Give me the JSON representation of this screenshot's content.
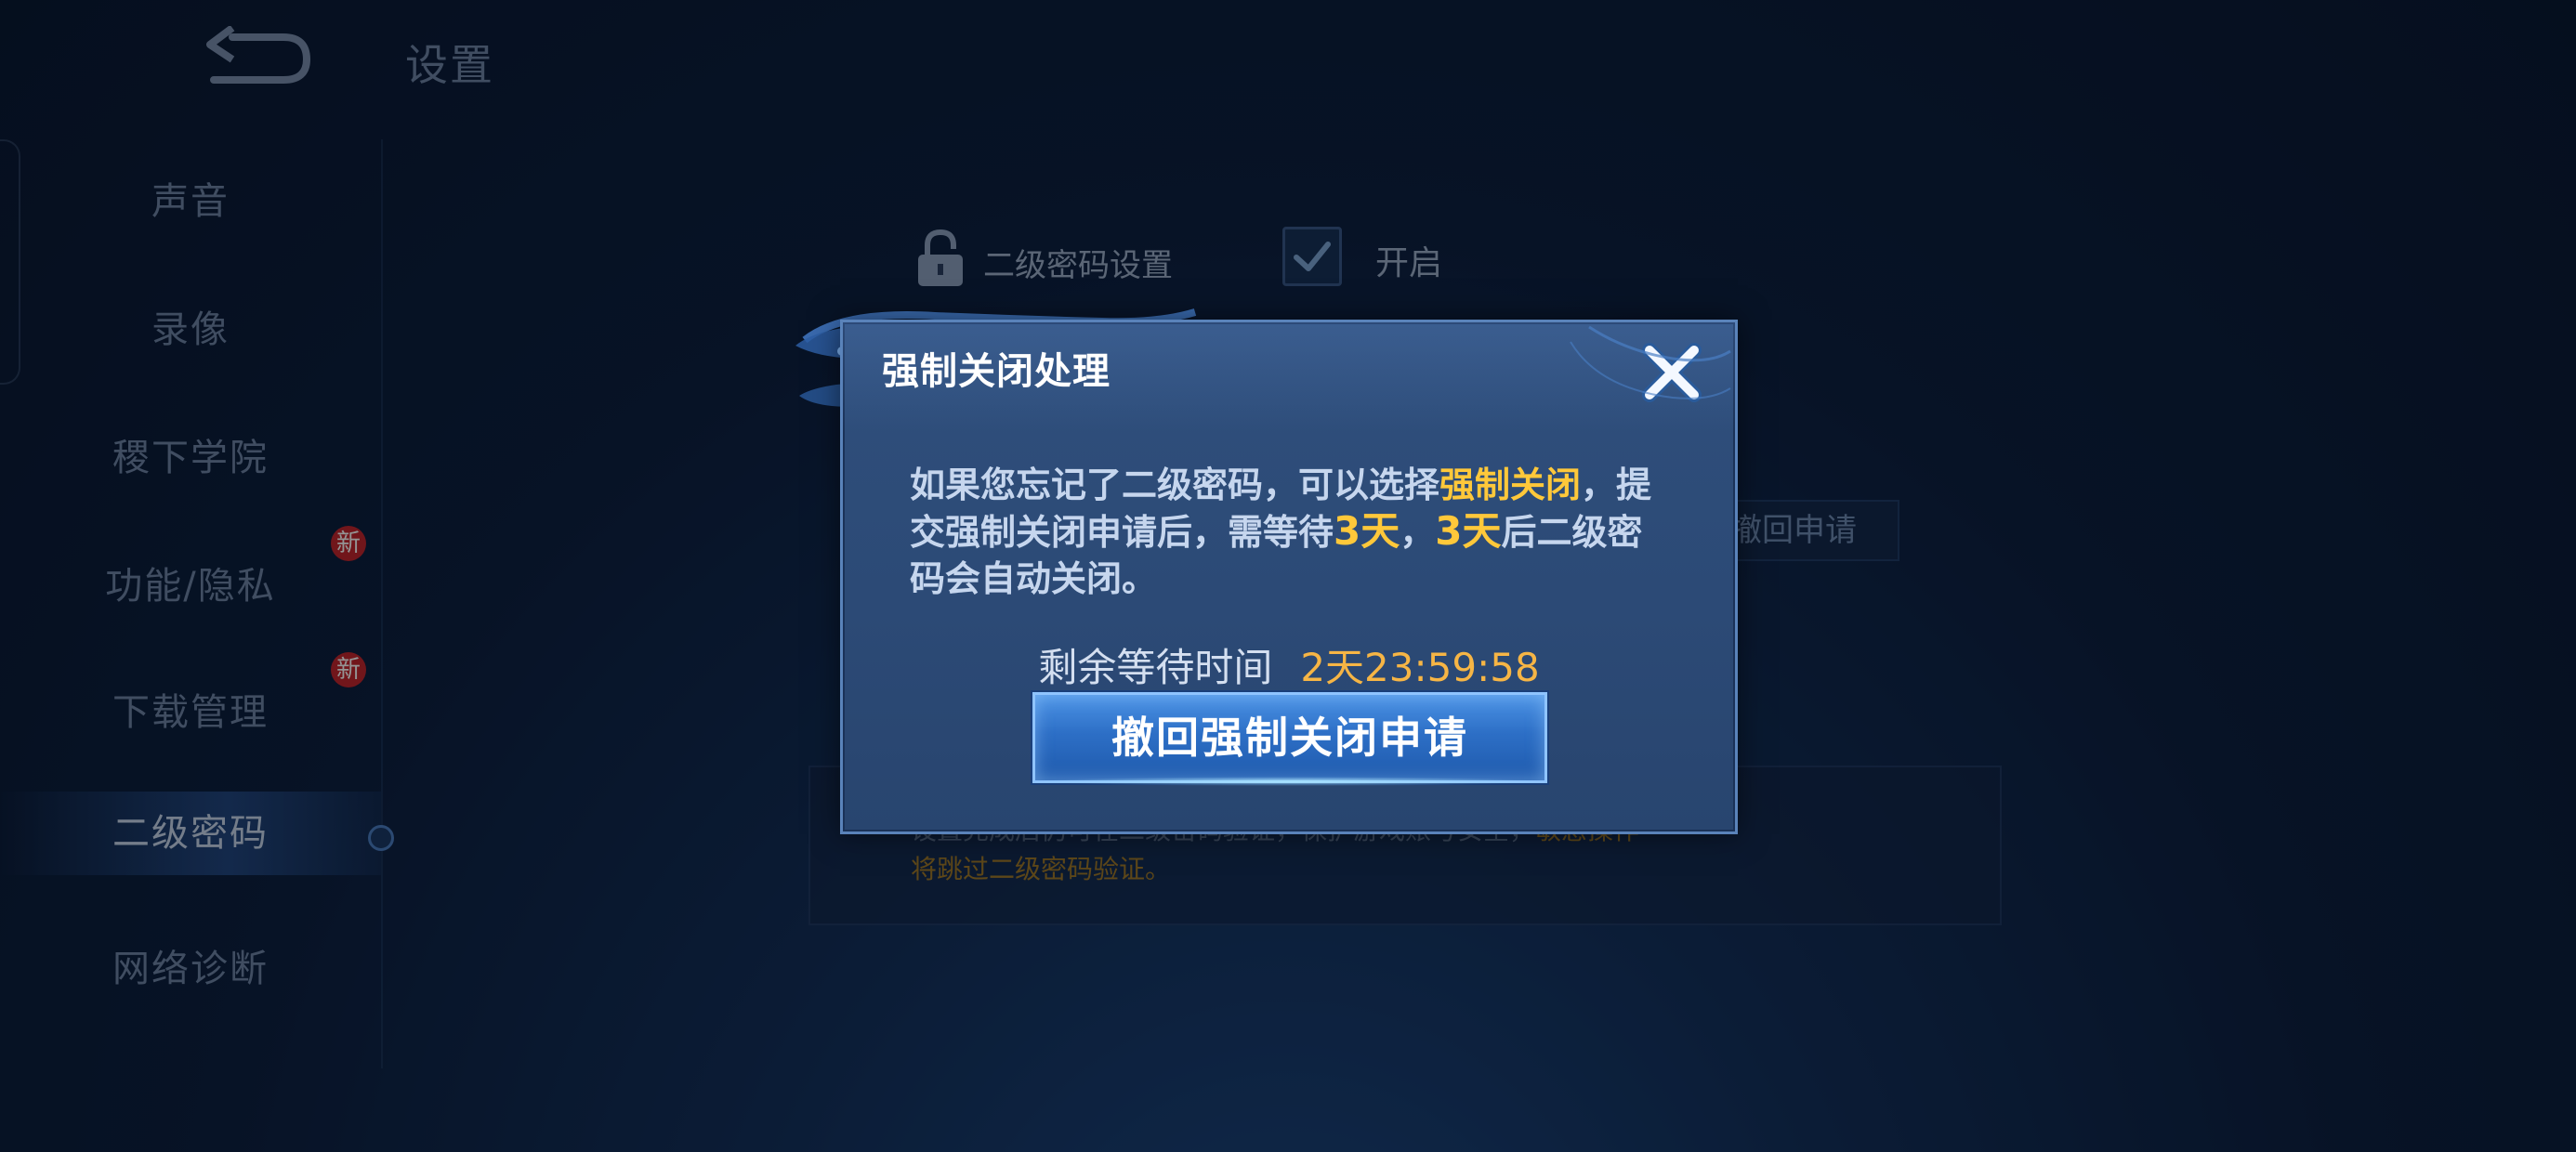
{
  "header": {
    "title": "设置"
  },
  "sidebar": {
    "items": [
      {
        "label": "声音",
        "badge": ""
      },
      {
        "label": "录像",
        "badge": ""
      },
      {
        "label": "稷下学院",
        "badge": ""
      },
      {
        "label": "功能/隐私",
        "badge": "新"
      },
      {
        "label": "下载管理",
        "badge": "新"
      },
      {
        "label": "二级密码",
        "badge": "",
        "active": true
      },
      {
        "label": "网络诊断",
        "badge": ""
      }
    ]
  },
  "settings": {
    "second_password_label": "二级密码设置",
    "enabled_label": "开启",
    "enabled_checked": true,
    "withdraw_bg_label": "撤回申请",
    "info_line1_prefix": "设置完成后仍可在二级密码验证，保护游戏账号安全，",
    "info_line1_highlight": "敏感操作",
    "info_line2": "将跳过二级密码验证。"
  },
  "modal": {
    "title": "强制关闭处理",
    "text_part1": "如果您忘记了二级密码，可以选择",
    "text_highlight1": "强制关闭",
    "text_part2": "，提交强制关闭申请后，需等待",
    "text_highlight2": "3天",
    "text_part3": "，",
    "text_highlight3": "3天",
    "text_part4": "后二级密码会自动关闭。",
    "timer_label": "剩余等待时间",
    "timer_value": "2天23:59:58",
    "button_label": "撤回强制关闭申请"
  },
  "colors": {
    "accent_yellow": "#ffc83a",
    "timer_orange": "#f6b545",
    "button_blue": "#2d6fc6",
    "badge_red": "#c3262f"
  }
}
